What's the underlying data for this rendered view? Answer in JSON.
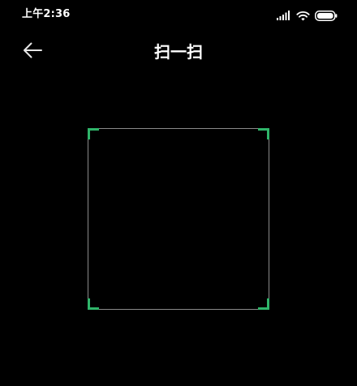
{
  "status_bar": {
    "time": "上午2:36",
    "icons": [
      "signal-icon",
      "wifi-icon",
      "battery-icon"
    ]
  },
  "header": {
    "back_icon": "arrow-left-icon",
    "title": "扫一扫"
  },
  "scan_frame": {
    "corner_color": "#2fb56a",
    "border_color": "#8a8a8a"
  },
  "colors": {
    "background": "#000000",
    "text": "#ffffff",
    "accent": "#2fb56a"
  }
}
